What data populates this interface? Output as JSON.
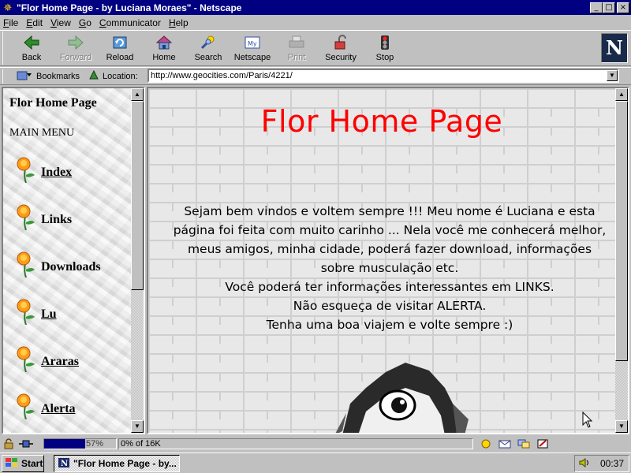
{
  "window": {
    "title": "\"Flor Home Page - by Luciana Moraes\" - Netscape",
    "buttons": {
      "minimize": "_",
      "maximize": "□",
      "close": "×"
    }
  },
  "menu": [
    "File",
    "Edit",
    "View",
    "Go",
    "Communicator",
    "Help"
  ],
  "toolbar": {
    "buttons": [
      {
        "label": "Back",
        "icon": "back-arrow-icon",
        "enabled": true
      },
      {
        "label": "Forward",
        "icon": "forward-arrow-icon",
        "enabled": false
      },
      {
        "label": "Reload",
        "icon": "reload-icon",
        "enabled": true
      },
      {
        "label": "Home",
        "icon": "home-icon",
        "enabled": true
      },
      {
        "label": "Search",
        "icon": "search-icon",
        "enabled": true
      },
      {
        "label": "Netscape",
        "icon": "netscape-icon",
        "enabled": true
      },
      {
        "label": "Print",
        "icon": "print-icon",
        "enabled": false
      },
      {
        "label": "Security",
        "icon": "security-lock-icon",
        "enabled": true
      },
      {
        "label": "Stop",
        "icon": "stop-icon",
        "enabled": true
      }
    ],
    "logo": "N"
  },
  "location": {
    "bookmarks_label": "Bookmarks",
    "location_label": "Location:",
    "url": "http://www.geocities.com/Paris/4221/"
  },
  "left_frame": {
    "title": "Flor Home Page",
    "menu_heading": "MAIN MENU",
    "items": [
      {
        "label": "Index",
        "underlined": true
      },
      {
        "label": "Links",
        "underlined": false
      },
      {
        "label": "Downloads",
        "underlined": false
      },
      {
        "label": "Lu",
        "underlined": true
      },
      {
        "label": "Araras",
        "underlined": true
      },
      {
        "label": "Alerta",
        "underlined": true
      }
    ]
  },
  "main_frame": {
    "title": "Flor Home Page",
    "intro_lines": [
      "Sejam bem vindos e voltem sempre !!! Meu nome é Luciana e esta",
      "página foi feita com muito carinho ... Nela você me conhecerá melhor,",
      "meus amigos, minha cidade, poderá fazer download, informações",
      "sobre musculação etc.",
      "Você poderá ter informações interessantes em LINKS.",
      "Não esqueça de visitar ALERTA.",
      "Tenha uma boa viajem e volte sempre :)"
    ],
    "title_color": "#ff0000"
  },
  "status": {
    "progress": {
      "percent": 57,
      "label": "57%"
    },
    "text": "0% of 16K"
  },
  "taskbar": {
    "start_label": "Start",
    "task_label": "\"Flor Home Page - by...",
    "clock": "00:37"
  }
}
